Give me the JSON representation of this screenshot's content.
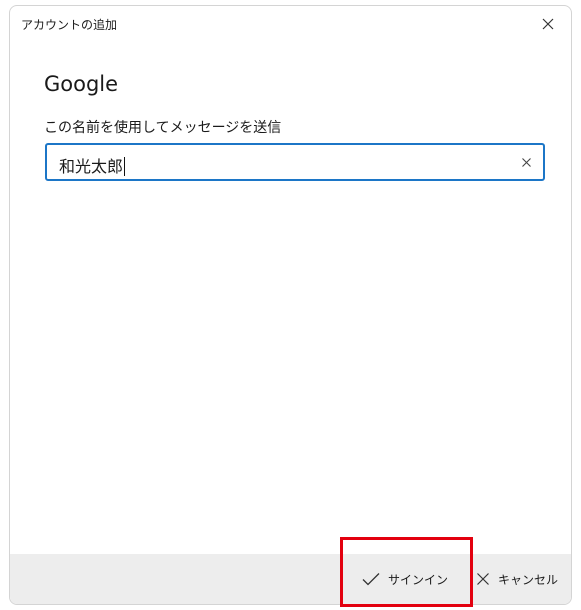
{
  "window": {
    "title": "アカウントの追加"
  },
  "main": {
    "heading": "Google",
    "field_label": "この名前を使用してメッセージを送信",
    "name_value": "和光太郎"
  },
  "footer": {
    "signin_label": "サインイン",
    "cancel_label": "キャンセル"
  },
  "icons": {
    "close": "close-icon",
    "clear": "clear-icon",
    "check": "check-icon",
    "cancel": "close-icon"
  },
  "colors": {
    "input_border": "#1c76c7",
    "footer_bg": "#ededed",
    "highlight": "#e3000f"
  }
}
